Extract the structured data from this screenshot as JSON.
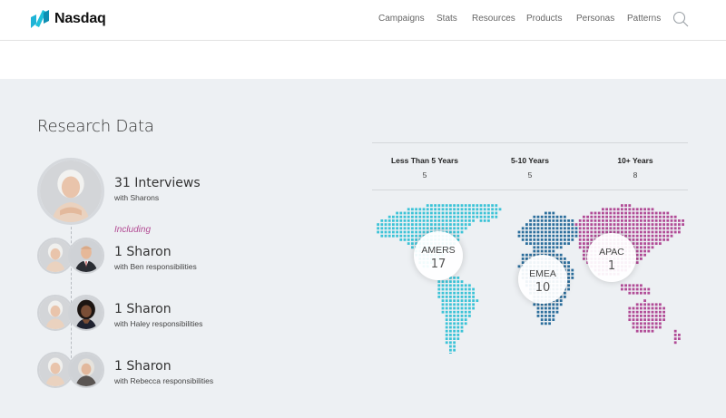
{
  "header": {
    "brand": "Nasdaq",
    "nav": [
      "Campaigns",
      "Stats",
      "Resources",
      "Products",
      "Personas",
      "Patterns"
    ]
  },
  "research": {
    "title": "Research Data",
    "summary": {
      "count_label": "31 Interviews",
      "sub_label": "with Sharons"
    },
    "including_label": "Including",
    "entries": [
      {
        "count_label": "1 Sharon",
        "sub_label": "with Ben responsibilities"
      },
      {
        "count_label": "1 Sharon",
        "sub_label": "with Haley responsibilities"
      },
      {
        "count_label": "1 Sharon",
        "sub_label": "with Rebecca responsibilities"
      }
    ]
  },
  "experience": [
    {
      "label": "Less Than 5 Years",
      "value": "5"
    },
    {
      "label": "5-10 Years",
      "value": "5"
    },
    {
      "label": "10+ Years",
      "value": "8"
    }
  ],
  "regions": [
    {
      "name": "AMERS",
      "value": "17",
      "color": "#3cc3d7"
    },
    {
      "name": "EMEA",
      "value": "10",
      "color": "#2c6e9c"
    },
    {
      "name": "APAC",
      "value": "1",
      "color": "#b14b96"
    }
  ],
  "colors": {
    "accent": "#b34c94",
    "brand": "#1fc0da",
    "section_bg": "#edf0f3"
  },
  "icons": {
    "logo": "nasdaq-logo-icon",
    "search": "search-icon"
  }
}
